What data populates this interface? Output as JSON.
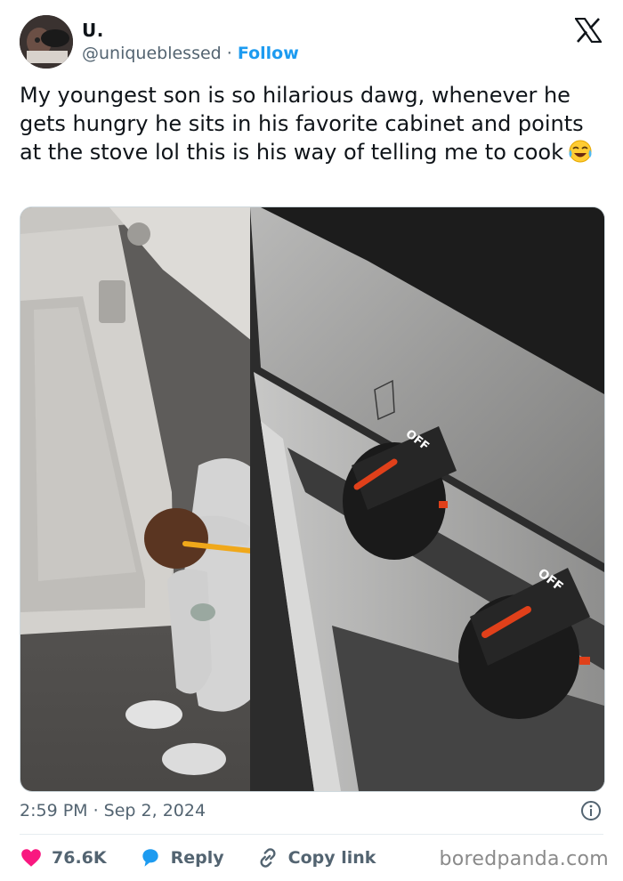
{
  "user": {
    "name": "U.",
    "handle": "@uniqueblessed",
    "separator": " · ",
    "follow_label": "Follow"
  },
  "tweet": {
    "text": "My youngest son is so hilarious dawg, whenever he gets hungry he sits in his favorite cabinet and points at the stove lol this is his way of telling me to cook",
    "emoji": "face-with-tears-of-joy",
    "timestamp": "2:59 PM · Sep 2, 2024"
  },
  "photo": {
    "knob1_label": "OFF",
    "knob2_label": "OFF"
  },
  "actions": {
    "like_count": "76.6K",
    "reply_label": "Reply",
    "copy_link_label": "Copy link"
  },
  "colors": {
    "accent": "#1d9bf0",
    "like": "#f91880",
    "text_secondary": "#536471"
  },
  "icons": [
    "x-logo-icon",
    "info-icon",
    "heart-icon",
    "reply-bubble-icon",
    "link-icon"
  ],
  "watermark": "boredpanda.com"
}
